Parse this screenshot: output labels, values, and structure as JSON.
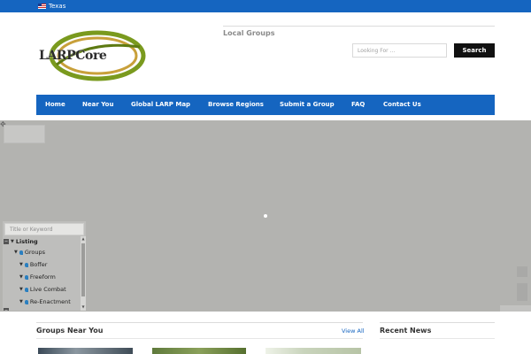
{
  "topbar": {
    "region": "Texas",
    "flag_icon": "us-flag-icon"
  },
  "brand": {
    "logo_text": "LARPCore",
    "colors": {
      "swoosh_green": "#7a9a1e",
      "swoosh_gold": "#c8a03a"
    }
  },
  "header": {
    "label": "Local Groups",
    "search": {
      "placeholder": "Looking For ...",
      "value": "",
      "button_label": "Search"
    }
  },
  "nav": {
    "items": [
      {
        "label": "Home"
      },
      {
        "label": "Near You"
      },
      {
        "label": "Global LARP Map"
      },
      {
        "label": "Browse Regions"
      },
      {
        "label": "Submit a Group"
      },
      {
        "label": "FAQ"
      },
      {
        "label": "Contact Us"
      }
    ]
  },
  "map": {
    "filter": {
      "keyword_placeholder": "Title or Keyword",
      "tree": [
        {
          "label": "Listing"
        },
        {
          "label": "Groups"
        },
        {
          "label": "Boffer"
        },
        {
          "label": "Freeform"
        },
        {
          "label": "Live Combat"
        },
        {
          "label": "Re-Enactment"
        }
      ]
    }
  },
  "sections": {
    "groups_near_you": {
      "title": "Groups Near You",
      "link": "View All"
    },
    "recent_news": {
      "title": "Recent News"
    }
  },
  "colors": {
    "accent": "#1565c0",
    "map_bg": "#b3b3b0",
    "button_dark": "#111111"
  }
}
